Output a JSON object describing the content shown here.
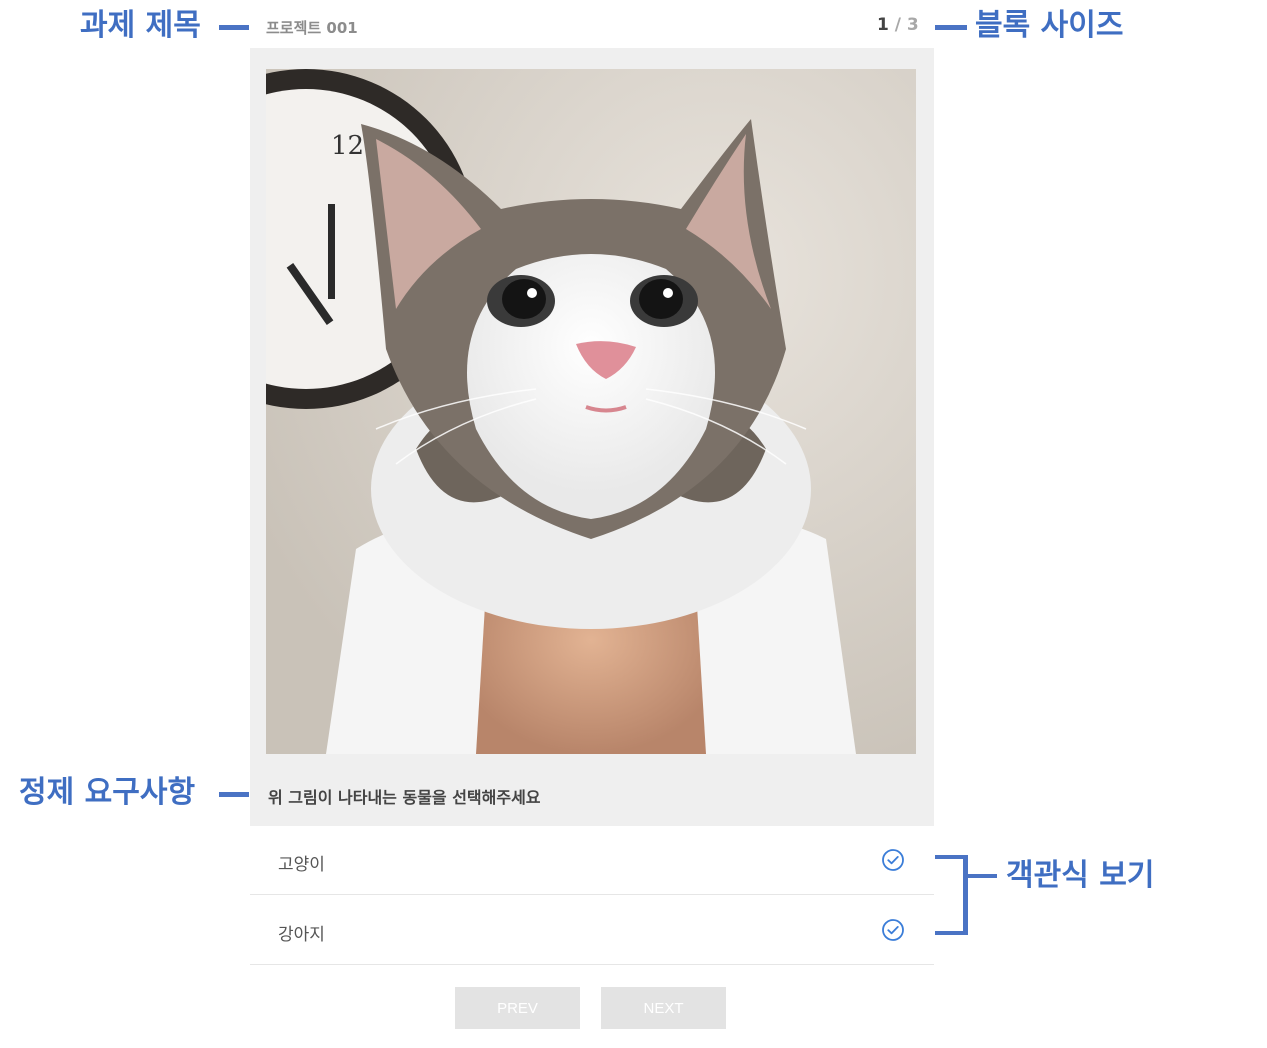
{
  "annotations": {
    "title_label": "과제 제목",
    "block_size_label": "블록 사이즈",
    "requirement_label": "정제 요구사항",
    "choices_label": "객관식 보기"
  },
  "header": {
    "project_title": "프로젝트 001",
    "current_page": "1",
    "separator": "/",
    "total_pages": "3"
  },
  "task": {
    "image_subject": "kitten",
    "requirement": "위 그림이 나타내는 동물을 선택해주세요"
  },
  "options": [
    {
      "label": "고양이",
      "icon": "check-circle-icon"
    },
    {
      "label": "강아지",
      "icon": "check-circle-icon"
    }
  ],
  "nav": {
    "prev_label": "PREV",
    "next_label": "NEXT"
  },
  "colors": {
    "annotation": "#3f6ec2",
    "panel_bg": "#efefef",
    "check": "#3b7dd8",
    "button_bg": "#e3e3e3"
  }
}
